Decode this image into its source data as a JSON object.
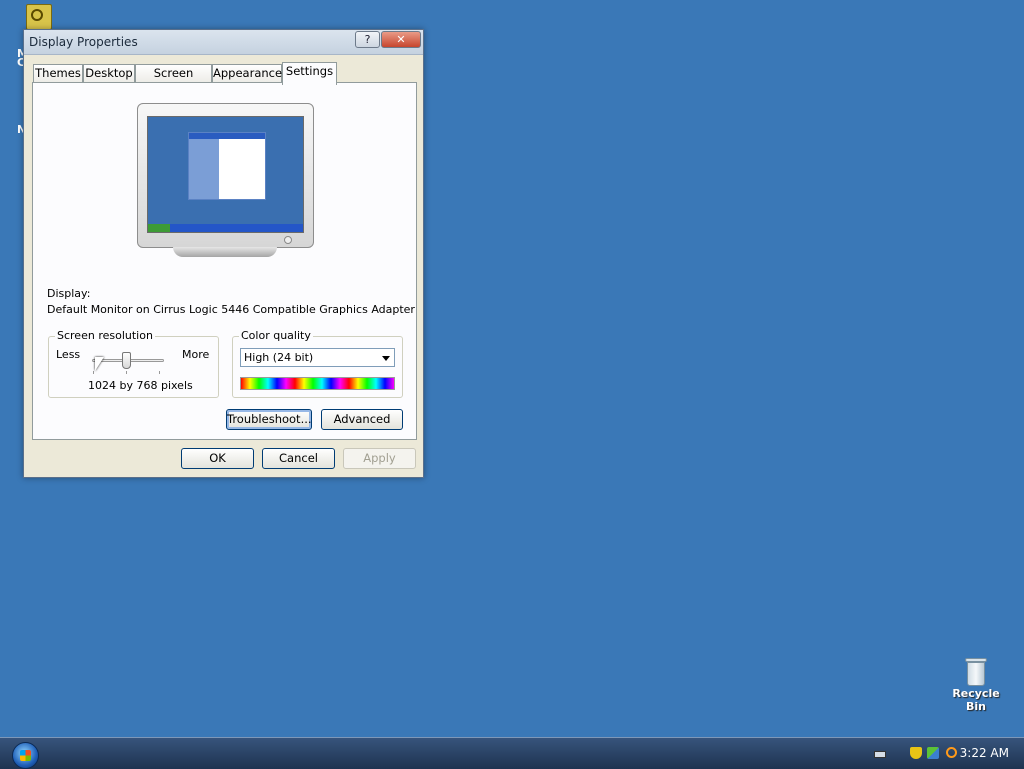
{
  "desktop": {
    "recycle_bin_label": "Recycle Bin",
    "partial_icon_labels": [
      "M",
      "C",
      "N"
    ]
  },
  "window": {
    "title": "Display Properties",
    "help_label": "?",
    "close_label": "✕",
    "tabs": [
      {
        "label": "Themes"
      },
      {
        "label": "Desktop"
      },
      {
        "label": "Screen Saver"
      },
      {
        "label": "Appearance"
      },
      {
        "label": "Settings",
        "active": true
      }
    ],
    "display_label": "Display:",
    "display_value": "Default Monitor on Cirrus Logic 5446 Compatible Graphics Adapter",
    "resolution": {
      "group_label": "Screen resolution",
      "less_label": "Less",
      "more_label": "More",
      "value_text": "1024 by 768 pixels"
    },
    "color_quality": {
      "group_label": "Color quality",
      "selected": "High (24 bit)"
    },
    "buttons": {
      "troubleshoot": "Troubleshoot...",
      "advanced": "Advanced",
      "ok": "OK",
      "cancel": "Cancel",
      "apply": "Apply"
    }
  },
  "taskbar": {
    "clock": "3:22 AM"
  }
}
